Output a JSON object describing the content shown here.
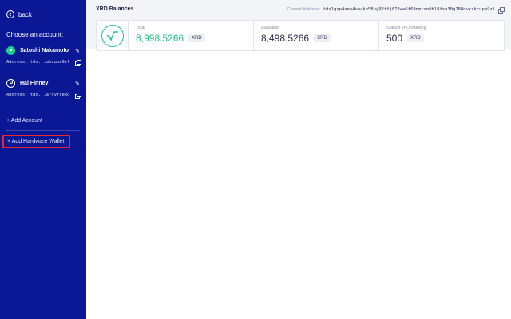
{
  "sidebar": {
    "back_label": "back",
    "choose_label": "Choose an account:",
    "accounts": [
      {
        "name": "Satoshi Nakamoto",
        "address": "Address: tdx...ukcupa9zl",
        "active": true
      },
      {
        "name": "Hal Finney",
        "address": "Address: tdx...arsvfsexd",
        "active": false
      }
    ],
    "add_account": "+ Add Account",
    "add_hardware": "+ Add Hardware Wallet"
  },
  "main": {
    "title": "XRD Balances",
    "current_address_label": "Current Address:",
    "current_address": "tdx1qsp4xea4uaakh58uy92tfj07fwe6f69nmrsn0hl8fxn30g784dvxskcupa9zl",
    "balances": [
      {
        "label": "Total",
        "amount": "8,998.5266",
        "token": "XRD"
      },
      {
        "label": "Available",
        "amount": "8,498.5266",
        "token": "XRD"
      },
      {
        "label": "Staked or Unstaking",
        "amount": "500",
        "token": "XRD"
      }
    ]
  },
  "colors": {
    "sidebar": "#0a1896",
    "accent": "#20c389",
    "highlight": "#e8262b"
  }
}
